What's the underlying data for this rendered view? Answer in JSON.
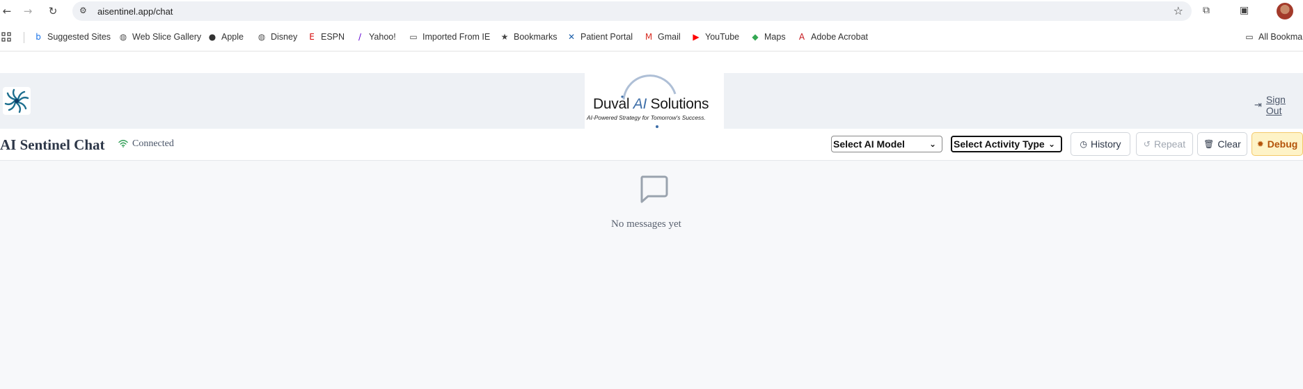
{
  "browser": {
    "url": "aisentinel.app/chat",
    "nav": {
      "back": "←",
      "forward": "→",
      "reload": "↻"
    },
    "bookmarks": [
      {
        "label": "Suggested Sites",
        "icon": "bing-icon",
        "glyph": "b",
        "color": "#1a73e8"
      },
      {
        "label": "Web Slice Gallery",
        "icon": "globe-icon",
        "glyph": "◍",
        "color": "#555"
      },
      {
        "label": "Apple",
        "icon": "apple-icon",
        "glyph": "●",
        "color": "#333"
      },
      {
        "label": "Disney",
        "icon": "globe-icon",
        "glyph": "◍",
        "color": "#555"
      },
      {
        "label": "ESPN",
        "icon": "espn-icon",
        "glyph": "E",
        "color": "#d50a0a"
      },
      {
        "label": "Yahoo!",
        "icon": "yahoo-icon",
        "glyph": "/",
        "color": "#6001d2"
      },
      {
        "label": "Imported From IE",
        "icon": "folder-icon",
        "glyph": "▭",
        "color": "#444"
      },
      {
        "label": "Bookmarks",
        "icon": "star-icon",
        "glyph": "★",
        "color": "#444"
      },
      {
        "label": "Patient Portal",
        "icon": "x-icon",
        "glyph": "✕",
        "color": "#1b5faa"
      },
      {
        "label": "Gmail",
        "icon": "gmail-icon",
        "glyph": "M",
        "color": "#d93025"
      },
      {
        "label": "YouTube",
        "icon": "youtube-icon",
        "glyph": "▶",
        "color": "#ff0000"
      },
      {
        "label": "Maps",
        "icon": "maps-icon",
        "glyph": "◆",
        "color": "#34a853"
      },
      {
        "label": "Adobe Acrobat",
        "icon": "acrobat-icon",
        "glyph": "A",
        "color": "#c4161c"
      }
    ],
    "all_bookmarks": "All Bookmarks"
  },
  "app": {
    "brand": {
      "name_prefix": "Duval ",
      "name_ai": "AI",
      "name_suffix": " Solutions",
      "tagline": "AI-Powered Strategy for Tomorrow's Success."
    },
    "sign_out": "Sign Out",
    "title": "AI Sentinel Chat",
    "status": "Connected",
    "model_select": "Select AI Model",
    "activity_select": "Select Activity Type",
    "buttons": {
      "history": "History",
      "repeat": "Repeat",
      "clear": "Clear",
      "debug": "Debug"
    },
    "empty_state": "No messages yet"
  },
  "colors": {
    "status": "#2f9e55",
    "debug_bg": "#fef3c7",
    "debug_text": "#b45309",
    "brand_accent": "#3d6ea8"
  }
}
